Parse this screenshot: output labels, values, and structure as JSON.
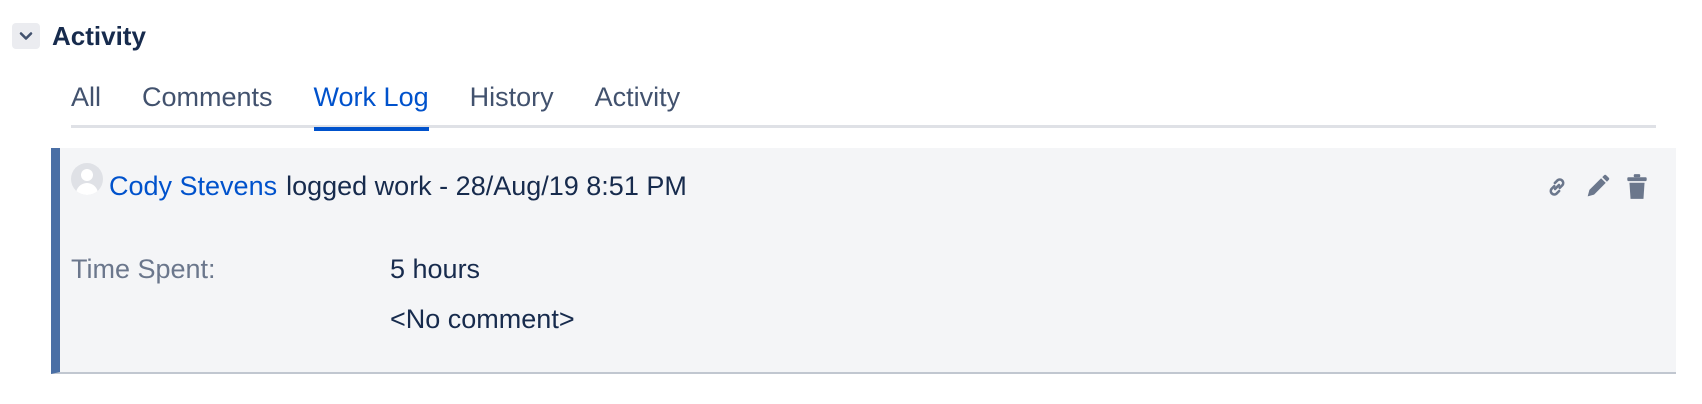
{
  "module": {
    "title": "Activity",
    "toggle_icon": "chevron-down-icon"
  },
  "tabs": [
    {
      "label": "All",
      "active": false
    },
    {
      "label": "Comments",
      "active": false
    },
    {
      "label": "Work Log",
      "active": true
    },
    {
      "label": "History",
      "active": false
    },
    {
      "label": "Activity",
      "active": false
    }
  ],
  "worklog": {
    "author": "Cody Stevens",
    "action_text": "logged work - 28/Aug/19 8:51 PM",
    "time_spent_label": "Time Spent:",
    "time_spent_value": "5 hours",
    "comment": "<No comment>",
    "actions": [
      "link-icon",
      "edit-icon",
      "delete-icon"
    ]
  },
  "colors": {
    "accent": "#0052cc",
    "entry_border": "#4a6fa5",
    "entry_background": "#f4f5f7",
    "text": "#172b4d",
    "muted": "#6b778c"
  }
}
